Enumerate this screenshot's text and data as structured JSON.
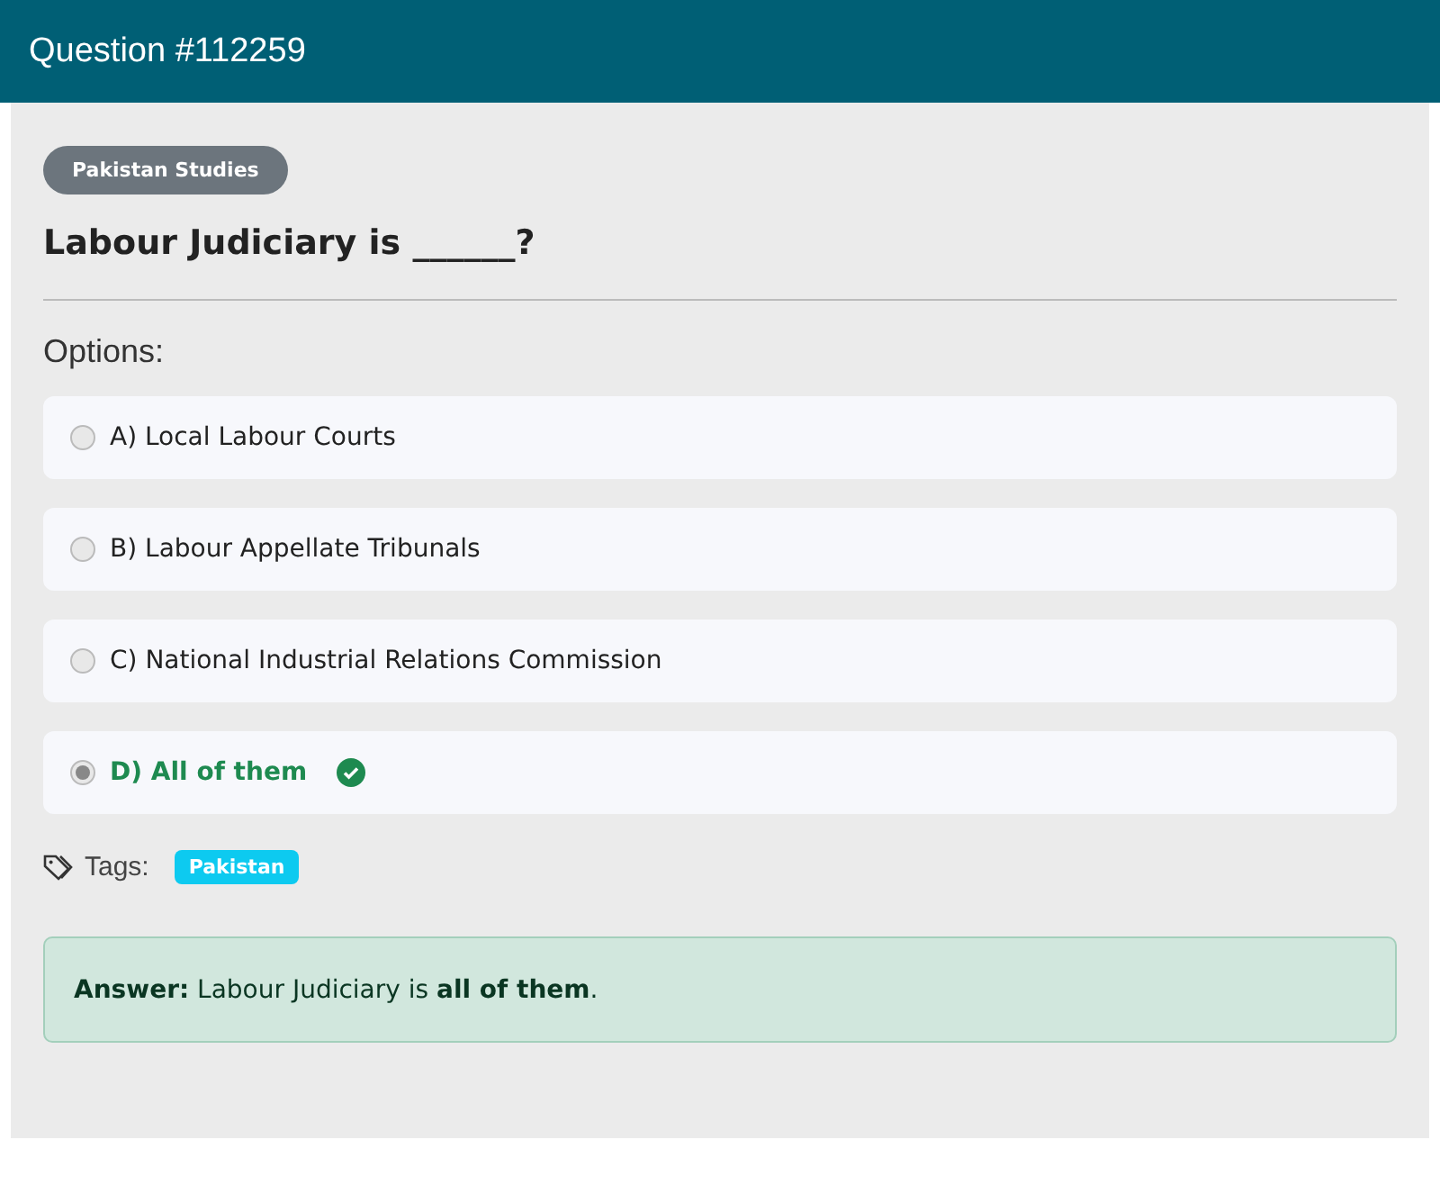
{
  "header": {
    "title": "Question #112259"
  },
  "category": "Pakistan Studies",
  "question": "Labour Judiciary is ______?",
  "options_label": "Options:",
  "options": [
    {
      "text": "A) Local Labour Courts",
      "selected": false,
      "correct": false
    },
    {
      "text": "B) Labour Appellate Tribunals",
      "selected": false,
      "correct": false
    },
    {
      "text": "C) National Industrial Relations Commission",
      "selected": false,
      "correct": false
    },
    {
      "text": "D) All of them",
      "selected": true,
      "correct": true
    }
  ],
  "tags_label": "Tags:",
  "tags": [
    "Pakistan"
  ],
  "answer": "**Answer:** Labour Judiciary is **all of them**."
}
